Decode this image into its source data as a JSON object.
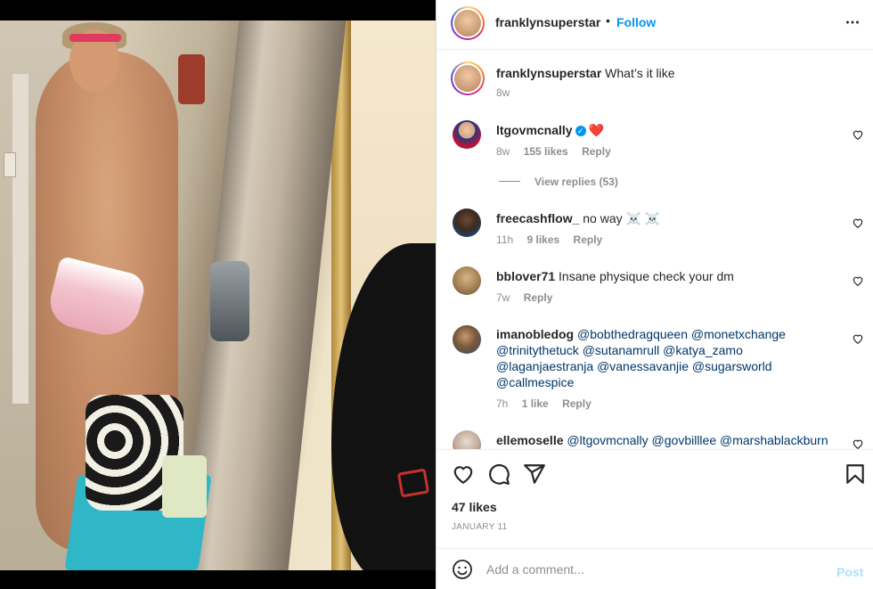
{
  "post": {
    "author": "franklynsuperstar",
    "follow_label": "Follow",
    "separator": "•",
    "caption_text": "What’s it like",
    "caption_age": "8w"
  },
  "comments": [
    {
      "user": "ltgovmcnally",
      "text": "❤️",
      "verified": true,
      "age": "8w",
      "likes": "155 likes",
      "reply": "Reply",
      "view_replies": "View replies (53)"
    },
    {
      "user": "freecashflow_",
      "text": "no way ☠️ ☠️",
      "age": "11h",
      "likes": "9 likes",
      "reply": "Reply"
    },
    {
      "user": "bblover71",
      "text": "Insane physique check your dm",
      "age": "7w",
      "reply": "Reply"
    },
    {
      "user": "imanobledog",
      "mentions": [
        "@bobthedragqueen",
        "@monetxchange",
        "@trinitythetuck",
        "@sutanamrull",
        "@katya_zamo",
        "@laganjaestranja",
        "@vanessavanjie",
        "@sugarsworld",
        "@callmespice"
      ],
      "age": "7h",
      "likes": "1 like",
      "reply": "Reply"
    },
    {
      "user": "ellemoselle",
      "mentions": [
        "@ltgovmcnally",
        "@govbilllee",
        "@marshablackburn"
      ]
    }
  ],
  "actions": {
    "likes": "47 likes",
    "date": "JANUARY 11"
  },
  "add_comment": {
    "placeholder": "Add a comment...",
    "post_label": "Post"
  },
  "colors": {
    "accent": "#0095f6",
    "mention": "#00376b",
    "muted": "#8e8e8e",
    "post_disabled": "#b2dffc"
  },
  "icons": [
    "more-icon",
    "heart-icon",
    "comment-icon",
    "share-icon",
    "bookmark-icon",
    "emoji-icon",
    "verified-badge-icon"
  ]
}
